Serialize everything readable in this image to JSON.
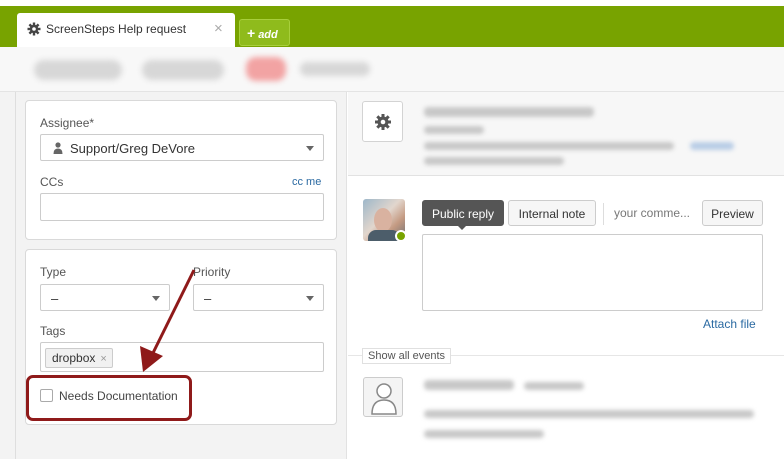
{
  "tab": {
    "title": "ScreenSteps Help request",
    "close": "×"
  },
  "add_button": {
    "plus": "+",
    "label": "add"
  },
  "assignee": {
    "label": "Assignee*",
    "value": "Support/Greg DeVore"
  },
  "ccs": {
    "label": "CCs",
    "link": "cc me",
    "value": ""
  },
  "type": {
    "label": "Type",
    "value": "–"
  },
  "priority": {
    "label": "Priority",
    "value": "–"
  },
  "tags": {
    "label": "Tags",
    "items": [
      {
        "label": "dropbox",
        "remove": "×"
      }
    ]
  },
  "needs_documentation": {
    "label": "Needs Documentation",
    "checked": false
  },
  "reply": {
    "public_label": "Public reply",
    "internal_label": "Internal note",
    "placeholder": "your comme...",
    "preview_label": "Preview",
    "attach_label": "Attach file"
  },
  "events": {
    "show_all_label": "Show all events"
  },
  "colors": {
    "brand_green": "#78a300",
    "annotation_red": "#8f1a1a",
    "link_blue": "#2b6aa2"
  }
}
